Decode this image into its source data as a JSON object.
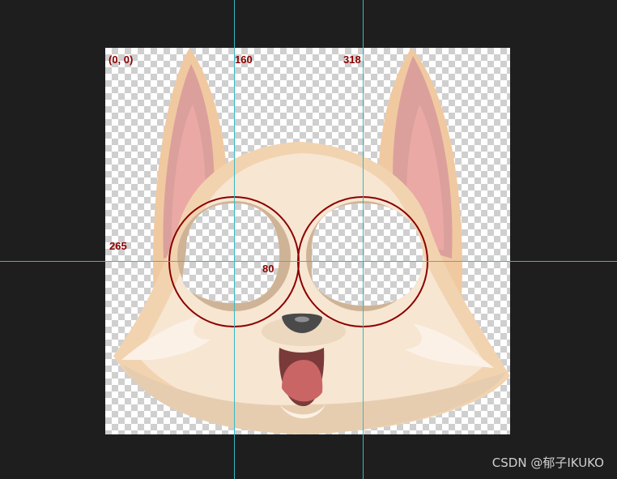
{
  "labels": {
    "origin": "(0, 0)",
    "x_first": "160",
    "x_second": "318",
    "y_value": "265",
    "radius": "80"
  },
  "watermark": "CSDN @郁子IKUKO",
  "colors": {
    "background": "#1e1e1e",
    "guide": "#35b8c4",
    "annotation": "#8b0000",
    "fur_light": "#f7e6d2",
    "fur_mid": "#f2cfa8",
    "ear_inner": "#eaa9a5",
    "nose": "#4a4a4a",
    "mouth": "#7a3a3a",
    "tongue": "#c96565"
  },
  "icons": {
    "canvas": "transparent-checkerboard",
    "character": "fox-face"
  }
}
